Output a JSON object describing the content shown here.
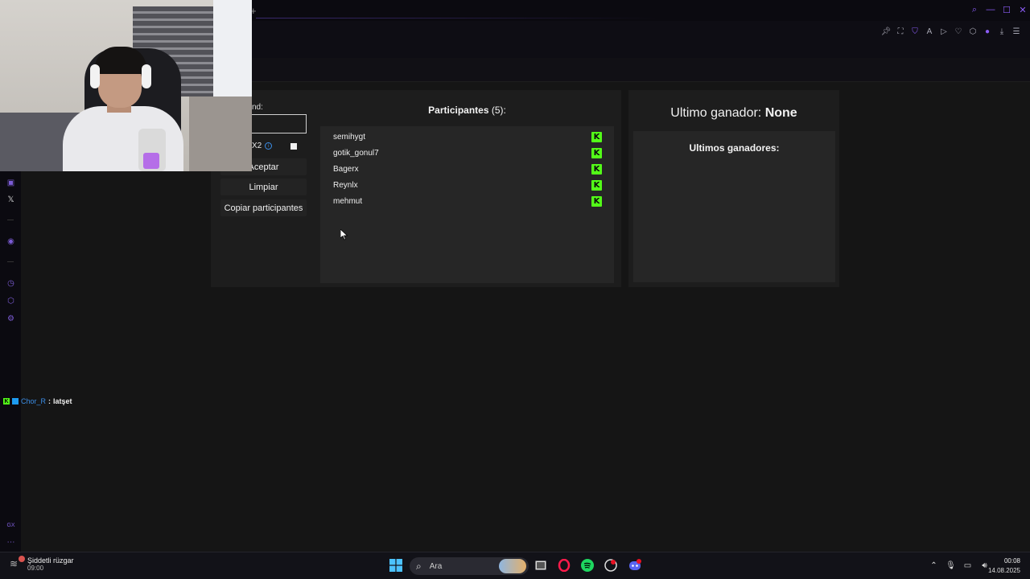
{
  "form": {
    "field_label": "nd:",
    "x2_label": "X2",
    "accept_button": "Aceptar",
    "clear_button": "Limpiar",
    "copy_button": "Copiar participantes"
  },
  "participants": {
    "title": "Participantes",
    "count": "(5):",
    "items": [
      {
        "name": "semihygt",
        "platform_icon": "kick-logo-icon"
      },
      {
        "name": "gotik_gonul7",
        "platform_icon": "kick-logo-icon"
      },
      {
        "name": "Bagerx",
        "platform_icon": "kick-logo-icon"
      },
      {
        "name": "Reynlx",
        "platform_icon": "kick-logo-icon"
      },
      {
        "name": "mehmut",
        "platform_icon": "kick-logo-icon"
      }
    ]
  },
  "winner": {
    "label": "Ultimo ganador:",
    "value": "None",
    "list_title": "Ultimos ganadores:"
  },
  "chat": {
    "user": "Chor_R",
    "separator": ":",
    "message": "latşet"
  },
  "taskbar": {
    "weather_title": "Şiddetli rüzgar",
    "weather_sub": "09:00",
    "search_placeholder": "Ara",
    "time": "00:08",
    "date": "14.08.2025"
  },
  "colors": {
    "kick_green": "#53fc18",
    "accent_purple": "#8b5cf6",
    "panel_bg": "#1d1d1d",
    "box_bg": "#262626"
  }
}
